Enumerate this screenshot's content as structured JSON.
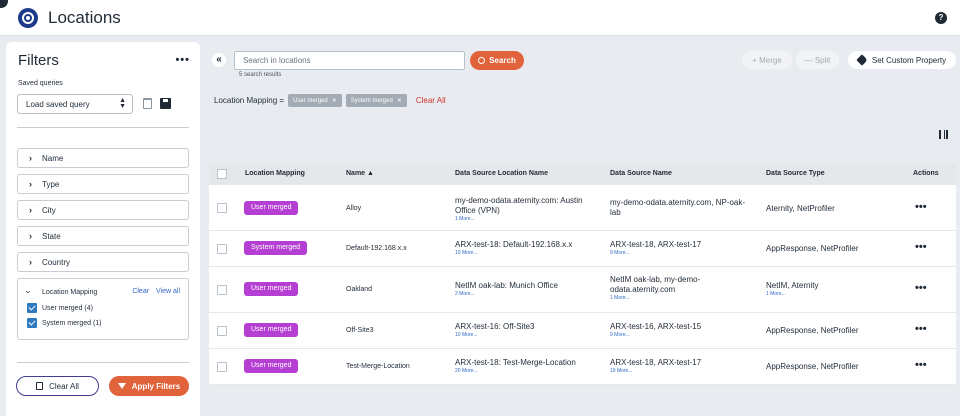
{
  "header": {
    "title": "Locations",
    "help_icon": "help-icon"
  },
  "filters": {
    "title": "Filters",
    "more_label": "•••",
    "saved_queries_label": "Saved queries",
    "saved_query_select": "Load saved query",
    "facets": [
      {
        "label": "Name"
      },
      {
        "label": "Type"
      },
      {
        "label": "City"
      },
      {
        "label": "State"
      },
      {
        "label": "Country"
      }
    ],
    "open_facet": {
      "label": "Location Mapping",
      "clear_label": "Clear",
      "view_all_label": "View all",
      "options": [
        {
          "label": "User merged  (4)",
          "checked": true
        },
        {
          "label": "System merged  (1)",
          "checked": true
        }
      ]
    },
    "clear_all_label": "Clear All",
    "apply_label": "Apply Filters"
  },
  "toolbar": {
    "collapse_label": "«",
    "search_placeholder": "Search in locations",
    "search_button": "Search",
    "result_count": "5 search results",
    "merge_label": "+ Merge",
    "split_label": "— Split",
    "custom_property_label": "Set Custom Property"
  },
  "criteria": {
    "prefix": "Location Mapping =",
    "chips": [
      "User merged",
      "System merged"
    ],
    "clear_all_label": "Clear All"
  },
  "table": {
    "columns": [
      "Location Mapping",
      "Name ▲",
      "Data Source Location Name",
      "Data Source Name",
      "Data Source Type",
      "Actions"
    ],
    "rows": [
      {
        "mapping": "User merged",
        "name": "Alloy",
        "ds_location": "my-demo-odata.aternity.com: Austin Office (VPN)",
        "ds_location_more": "1 More...",
        "ds_name": "my-demo-odata.aternity.com, NP-oak-lab",
        "ds_name_more": "",
        "ds_type": "Aternity, NetProfiler",
        "ds_type_more": "",
        "actions": "•••"
      },
      {
        "mapping": "System merged",
        "name": "Default-192.168.x.x",
        "ds_location": "ARX-test-18: Default-192.168.x.x",
        "ds_location_more": "10 More...",
        "ds_name": "ARX-test-18, ARX-test-17",
        "ds_name_more": "9 More...",
        "ds_type": "AppResponse, NetProfiler",
        "ds_type_more": "",
        "actions": "•••"
      },
      {
        "mapping": "User merged",
        "name": "Oakland",
        "ds_location": "NetIM oak-lab: Munich Office",
        "ds_location_more": "2 More...",
        "ds_name": "NetIM oak-lab, my-demo-odata.aternity.com",
        "ds_name_more": "1 More...",
        "ds_type": "NetIM, Aternity",
        "ds_type_more": "1 More...",
        "actions": "•••"
      },
      {
        "mapping": "User merged",
        "name": "Off-Site3",
        "ds_location": "ARX-test-16: Off-Site3",
        "ds_location_more": "10 More...",
        "ds_name": "ARX-test-16, ARX-test-15",
        "ds_name_more": "9 More...",
        "ds_type": "AppResponse, NetProfiler",
        "ds_type_more": "",
        "actions": "•••"
      },
      {
        "mapping": "User merged",
        "name": "Test-Merge-Location",
        "ds_location": "ARX-test-18: Test-Merge-Location",
        "ds_location_more": "20 More...",
        "ds_name": "ARX-test-18, ARX-test-17",
        "ds_name_more": "19 More...",
        "ds_type": "AppResponse, NetProfiler",
        "ds_type_more": "",
        "actions": "•••"
      }
    ]
  },
  "colors": {
    "accent": "#e0633b",
    "badge": "#b53ed3",
    "link": "#2f66c6",
    "brand": "#1d3a8a"
  }
}
